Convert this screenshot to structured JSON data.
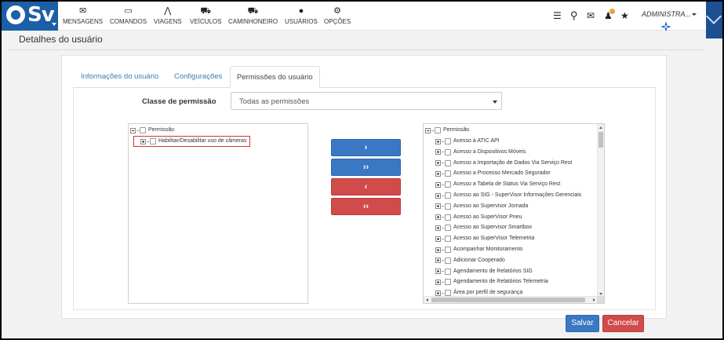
{
  "logo": {
    "text": "Sv"
  },
  "nav": {
    "items": [
      {
        "label": "MENSAGENS",
        "icon": "envelope-icon",
        "glyph": "✉"
      },
      {
        "label": "COMANDOS",
        "icon": "monitor-icon",
        "glyph": "▭"
      },
      {
        "label": "VIAGENS",
        "icon": "road-icon",
        "glyph": "⋀"
      },
      {
        "label": "VEÍCULOS",
        "icon": "car-icon",
        "glyph": "⛟"
      },
      {
        "label": "CAMINHONEIRO",
        "icon": "truck-icon",
        "glyph": "⛟"
      },
      {
        "label": "USUÁRIOS",
        "icon": "user-icon",
        "glyph": "●"
      },
      {
        "label": "OPÇÕES",
        "icon": "cogs-icon",
        "glyph": "⚙"
      }
    ]
  },
  "topbar": {
    "list_icon": "☰",
    "search_icon": "⚲",
    "mail_icon": "✉",
    "bell_icon": "♟",
    "star_icon": "★",
    "notification_badge": "",
    "user": "ADMINISTRA..."
  },
  "page": {
    "title": "Detalhes do usuário"
  },
  "tabs": [
    {
      "label": "Informações do usuário",
      "active": false
    },
    {
      "label": "Configurações",
      "active": false
    },
    {
      "label": "Permissões do usuário",
      "active": true
    }
  ],
  "permission_class": {
    "label": "Classe de permissão",
    "value": "Todas as permissões"
  },
  "left_tree": {
    "root": "Permissão",
    "children": [
      "Habilitar/Desabilitar uso de câmeras"
    ]
  },
  "right_tree": {
    "root": "Permissão",
    "children": [
      "Acesso à ATIC API",
      "Acesso a Dispositivos Móveis",
      "Acesso a Importação de Dados Via Serviço Rest",
      "Acesso a Processo Mercado Segurador",
      "Acesso a Tabela de Status Via Serviço Rest",
      "Acesso ao SIG - SuperVisor Informações Gerenciais",
      "Acesso ao Supervisor Jornada",
      "Acesso ao SuperVisor Pneu",
      "Acesso ao Supervisor Smartbox",
      "Acesso ao SuperVisor Telemetria",
      "Acompanhar Monitoramento",
      "Adicionar Cooperado",
      "Agendamento de Relatórios SIG",
      "Agendamento de Relatórios Telemetria",
      "Área por perfil de segurança"
    ]
  },
  "transfer": {
    "move_selected": "›",
    "move_all": "››",
    "remove_selected": "‹",
    "remove_all": "‹‹"
  },
  "actions": {
    "save": "Salvar",
    "cancel": "Cancelar"
  },
  "colors": {
    "brand": "#1b5fa6",
    "primary": "#3a78c3",
    "danger": "#d14b4b",
    "highlight": "#d53232"
  }
}
